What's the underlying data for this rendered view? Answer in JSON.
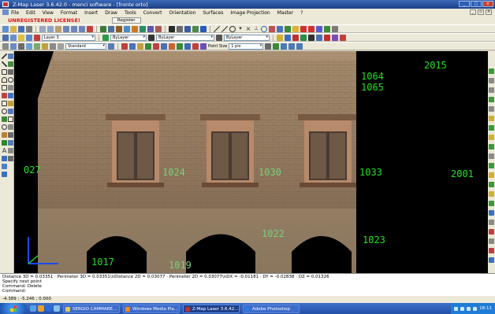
{
  "window": {
    "title": "Z-Map Laser 3.6.42.0 - menci software - [fronte orto]"
  },
  "menu": [
    "File",
    "Edit",
    "View",
    "Format",
    "Insert",
    "Draw",
    "Tools",
    "Convert",
    "Orientation",
    "Surfaces",
    "Image Projection",
    "Master",
    "?"
  ],
  "license": {
    "label": "UNREGISTERED LICENSE!",
    "register_button": "Register"
  },
  "toolbar2": {
    "layer": "Layer 3",
    "color": "ByLayer",
    "linetype": "ByLayer",
    "lineweight": "ByLayer"
  },
  "toolbar3": {
    "style": "Standard",
    "point_size_label": "Point Size",
    "point_size": "1 pix"
  },
  "viewport": {
    "labels": [
      {
        "id": "label-2015",
        "text": "2015"
      },
      {
        "id": "label-1064",
        "text": "1064"
      },
      {
        "id": "label-1065",
        "text": "1065"
      },
      {
        "id": "label-027",
        "text": "027"
      },
      {
        "id": "label-1024",
        "text": "1024"
      },
      {
        "id": "label-1030",
        "text": "1030"
      },
      {
        "id": "label-1033",
        "text": "1033"
      },
      {
        "id": "label-2001",
        "text": "2001"
      },
      {
        "id": "label-1022",
        "text": "1022"
      },
      {
        "id": "label-1023",
        "text": "1023"
      },
      {
        "id": "label-1017",
        "text": "1017"
      },
      {
        "id": "label-1019",
        "text": "1019"
      }
    ]
  },
  "command": {
    "lines": [
      "Distance 3D = 0.03351 · Perimeter 3D = 0.03351\\nDistance 2D = 0.03077 · Perimeter 2D = 0.03077\\nDX = -0.01181 · DY = -0.02838 · DZ = 0.01326",
      "Specify next point",
      "Command: Delete",
      "Command:"
    ]
  },
  "status": {
    "coords": "-4.389 ; -5.246 ; 0.000"
  },
  "taskbar": {
    "tasks": [
      {
        "label": "SERGIO CAMMARE...",
        "color": "#e8c84a",
        "active": false
      },
      {
        "label": "Windows Media Pla...",
        "color": "#f08a1a",
        "active": false
      },
      {
        "label": "Z-Map Laser 3.6.42...",
        "color": "#c03030",
        "active": true
      },
      {
        "label": "Adobe Photoshop",
        "color": "#2a7be0",
        "active": false
      }
    ],
    "clock": "18:11"
  },
  "colors": {
    "label_green": "#20e020",
    "titlebar": "#1c3f86",
    "license_red": "#e01010"
  }
}
